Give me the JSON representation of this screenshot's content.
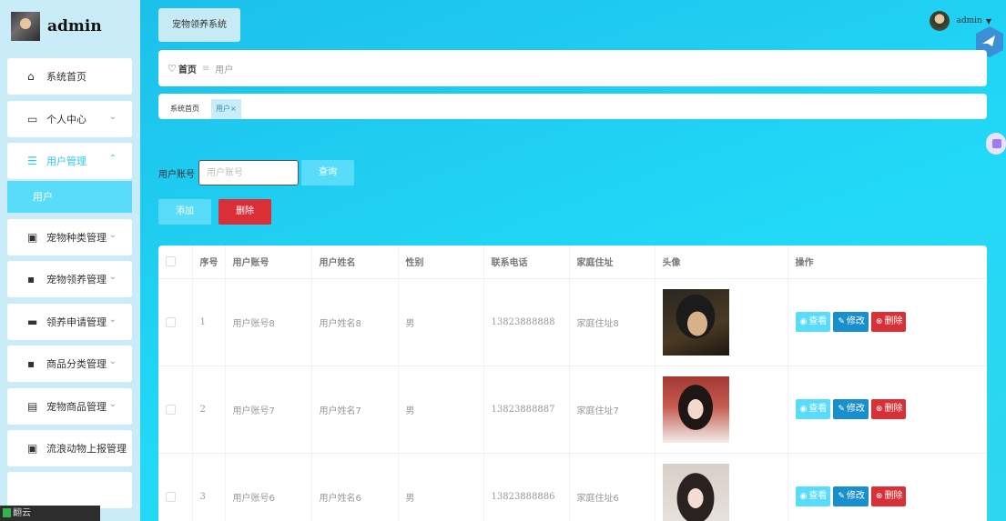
{
  "logo": {
    "text": "admin"
  },
  "sidebar": {
    "items": [
      {
        "label": "系统首页",
        "icon": "home-icon",
        "glyph": "⌂"
      },
      {
        "label": "个人中心",
        "icon": "wallet-icon",
        "glyph": "▭",
        "chevron": "⌄"
      },
      {
        "label": "用户管理",
        "icon": "sliders-icon",
        "glyph": "☰",
        "chevron": "⌃",
        "active": true
      },
      {
        "label": "宠物种类管理",
        "icon": "clipboard-icon",
        "glyph": "▣",
        "chevron": "⌄"
      },
      {
        "label": "宠物领养管理",
        "icon": "grid-icon",
        "glyph": "▪",
        "chevron": "⌄"
      },
      {
        "label": "领养申请管理",
        "icon": "monitor-icon",
        "glyph": "▬",
        "chevron": "⌄"
      },
      {
        "label": "商品分类管理",
        "icon": "grid-icon",
        "glyph": "▪",
        "chevron": "⌄"
      },
      {
        "label": "宠物商品管理",
        "icon": "briefcase-icon",
        "glyph": "▤",
        "chevron": "⌄"
      },
      {
        "label": "流浪动物上报管理",
        "icon": "clipboard-icon",
        "glyph": "▣"
      }
    ],
    "submenu_label": "用户"
  },
  "header": {
    "system_button": "宠物领养系统",
    "username": "admin",
    "caret": "▼"
  },
  "breadcrumb": {
    "home": "首页",
    "separator": "≡",
    "current": "用户"
  },
  "tags": [
    {
      "label": "系统首页"
    },
    {
      "label": "用户",
      "close": "×",
      "active": true
    }
  ],
  "search": {
    "label": "用户账号",
    "placeholder": "用户账号",
    "value": "",
    "query_button": "查询"
  },
  "actions": {
    "add": "添加",
    "delete": "删除"
  },
  "table": {
    "headers": [
      "序号",
      "用户账号",
      "用户姓名",
      "性别",
      "联系电话",
      "家庭住址",
      "头像",
      "操作"
    ],
    "rows": [
      {
        "index": "1",
        "account": "用户账号8",
        "name": "用户姓名8",
        "gender": "男",
        "phone": "13823888888",
        "address": "家庭住址8"
      },
      {
        "index": "2",
        "account": "用户账号7",
        "name": "用户姓名7",
        "gender": "男",
        "phone": "13823888887",
        "address": "家庭住址7"
      },
      {
        "index": "3",
        "account": "用户账号6",
        "name": "用户姓名6",
        "gender": "男",
        "phone": "13823888886",
        "address": "家庭住址6"
      }
    ],
    "row_actions": {
      "view": "查看",
      "edit": "修改",
      "delete": "删除"
    }
  },
  "bottom_bar": {
    "text": "翻云",
    "icon": "app-icon"
  },
  "colors": {
    "accent": "#59dcf9",
    "danger": "#db2f38",
    "edit": "#1a8fcc",
    "sidebar_bg": "#c9ecf8",
    "main_bg": "#22d8f7"
  }
}
